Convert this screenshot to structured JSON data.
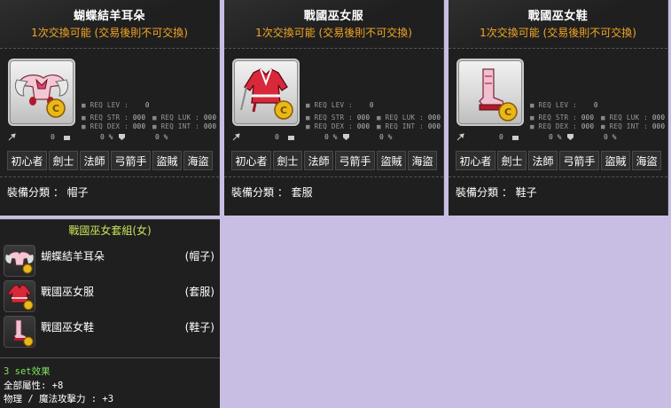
{
  "items": [
    {
      "name": "蝴蝶結羊耳朵",
      "trade_note": "1次交換可能 (交易後則不可交換)",
      "req_lev_label": "REQ LEV :",
      "req_lev_value": "0",
      "req_str_label": "REQ STR :",
      "req_str_value": "000",
      "req_luk_label": "REQ LUK :",
      "req_luk_value": "000",
      "req_dex_label": "REQ DEX :",
      "req_dex_value": "000",
      "req_int_label": "REQ INT :",
      "req_int_value": "000",
      "stat_a": "0",
      "stat_b": "0 %",
      "stat_c": "0 %",
      "jobs": [
        "初心者",
        "劍士",
        "法師",
        "弓箭手",
        "盜賊",
        "海盜"
      ],
      "category_label": "裝備分類 ：",
      "category_value": "帽子",
      "icon": "pink-bow-sheep-ears-hat-icon"
    },
    {
      "name": "戰國巫女服",
      "trade_note": "1次交換可能 (交易後則不可交換)",
      "req_lev_label": "REQ LEV :",
      "req_lev_value": "0",
      "req_str_label": "REQ STR :",
      "req_str_value": "000",
      "req_luk_label": "REQ LUK :",
      "req_luk_value": "000",
      "req_dex_label": "REQ DEX :",
      "req_dex_value": "000",
      "req_int_label": "REQ INT :",
      "req_int_value": "000",
      "stat_a": "0",
      "stat_b": "0 %",
      "stat_c": "0 %",
      "jobs": [
        "初心者",
        "劍士",
        "法師",
        "弓箭手",
        "盜賊",
        "海盜"
      ],
      "category_label": "裝備分類 ：",
      "category_value": "套服",
      "icon": "red-shrine-maiden-outfit-icon"
    },
    {
      "name": "戰國巫女鞋",
      "trade_note": "1次交換可能 (交易後則不可交換)",
      "req_lev_label": "REQ LEV :",
      "req_lev_value": "0",
      "req_str_label": "REQ STR :",
      "req_str_value": "000",
      "req_luk_label": "REQ LUK :",
      "req_luk_value": "000",
      "req_dex_label": "REQ DEX :",
      "req_dex_value": "000",
      "req_int_label": "REQ INT :",
      "req_int_value": "000",
      "stat_a": "0",
      "stat_b": "0 %",
      "stat_c": "0 %",
      "jobs": [
        "初心者",
        "劍士",
        "法師",
        "弓箭手",
        "盜賊",
        "海盜"
      ],
      "category_label": "裝備分類 ：",
      "category_value": "鞋子",
      "icon": "pink-shrine-maiden-shoes-icon"
    }
  ],
  "set": {
    "title": "戰國巫女套組(女)",
    "items": [
      {
        "name": "蝴蝶結羊耳朵",
        "type": "(帽子)",
        "icon": "hat-icon"
      },
      {
        "name": "戰國巫女服",
        "type": "(套服)",
        "icon": "outfit-icon"
      },
      {
        "name": "戰國巫女鞋",
        "type": "(鞋子)",
        "icon": "shoes-icon"
      }
    ],
    "effect_header": "3 set效果",
    "effect_lines": [
      "全部屬性: +8",
      "物理 / 魔法攻擊力 : +3"
    ]
  },
  "colors": {
    "panel_bg": "#1f1f1f",
    "page_bg": "#c8bee4",
    "trade_note": "#f5a623",
    "set_title": "#c8e35a",
    "set_effect_header": "#7ee35a"
  }
}
